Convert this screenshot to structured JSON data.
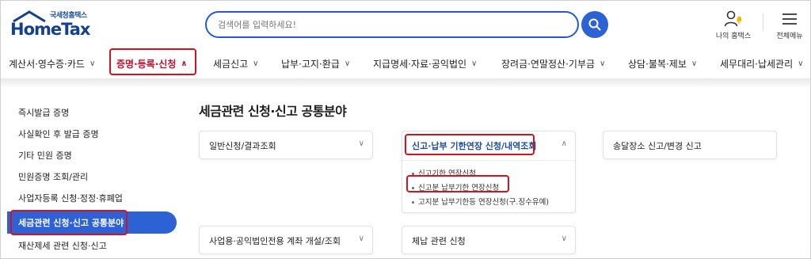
{
  "header": {
    "logo_sub": "국세청홈택스",
    "logo_main": "HomeTax",
    "search_placeholder": "검색어를 입력하세요!",
    "my_hometax_label": "나의 홈택스",
    "all_menu_label": "전체메뉴"
  },
  "nav": {
    "items": [
      {
        "label": "계산서·영수증·카드"
      },
      {
        "label": "증명·등록·신청"
      },
      {
        "label": "세금신고"
      },
      {
        "label": "납부·고지·환급"
      },
      {
        "label": "지급명세·자료·공익법인"
      },
      {
        "label": "장려금·연말정산·기부금"
      },
      {
        "label": "상담·불복·제보"
      },
      {
        "label": "세무대리·납세관리"
      }
    ],
    "chevron_down": "∨",
    "chevron_up": "∧"
  },
  "sidebar": {
    "items": [
      {
        "label": "즉시발급 증명"
      },
      {
        "label": "사실확인 후 발급 증명"
      },
      {
        "label": "기타 민원 증명"
      },
      {
        "label": "민원증명 조회/관리"
      },
      {
        "label": "사업자등록 신청·정정·휴폐업"
      },
      {
        "label": "세금관련 신청·신고 공통분야"
      },
      {
        "label": "재산제세 관련 신청·신고"
      }
    ]
  },
  "main": {
    "title": "세금관련 신청·신고 공통분야",
    "cards": [
      {
        "label": "일반신청/결과조회"
      },
      {
        "label": "신고·납부 기한연장 신청/내역조회",
        "subitems": [
          "신고기한 연장신청",
          "신고분 납부기한 연장신청",
          "고지분 납부기한등 연장신청(구.징수유예)"
        ]
      },
      {
        "label": "송달장소 신고/변경 신고"
      },
      {
        "label": "사업용·공익법인전용 계좌 개설/조회"
      },
      {
        "label": "체납 관련 신청"
      }
    ]
  },
  "colors": {
    "accent": "#2d62d4",
    "highlight": "#d7121f",
    "brand": "#15418c"
  }
}
